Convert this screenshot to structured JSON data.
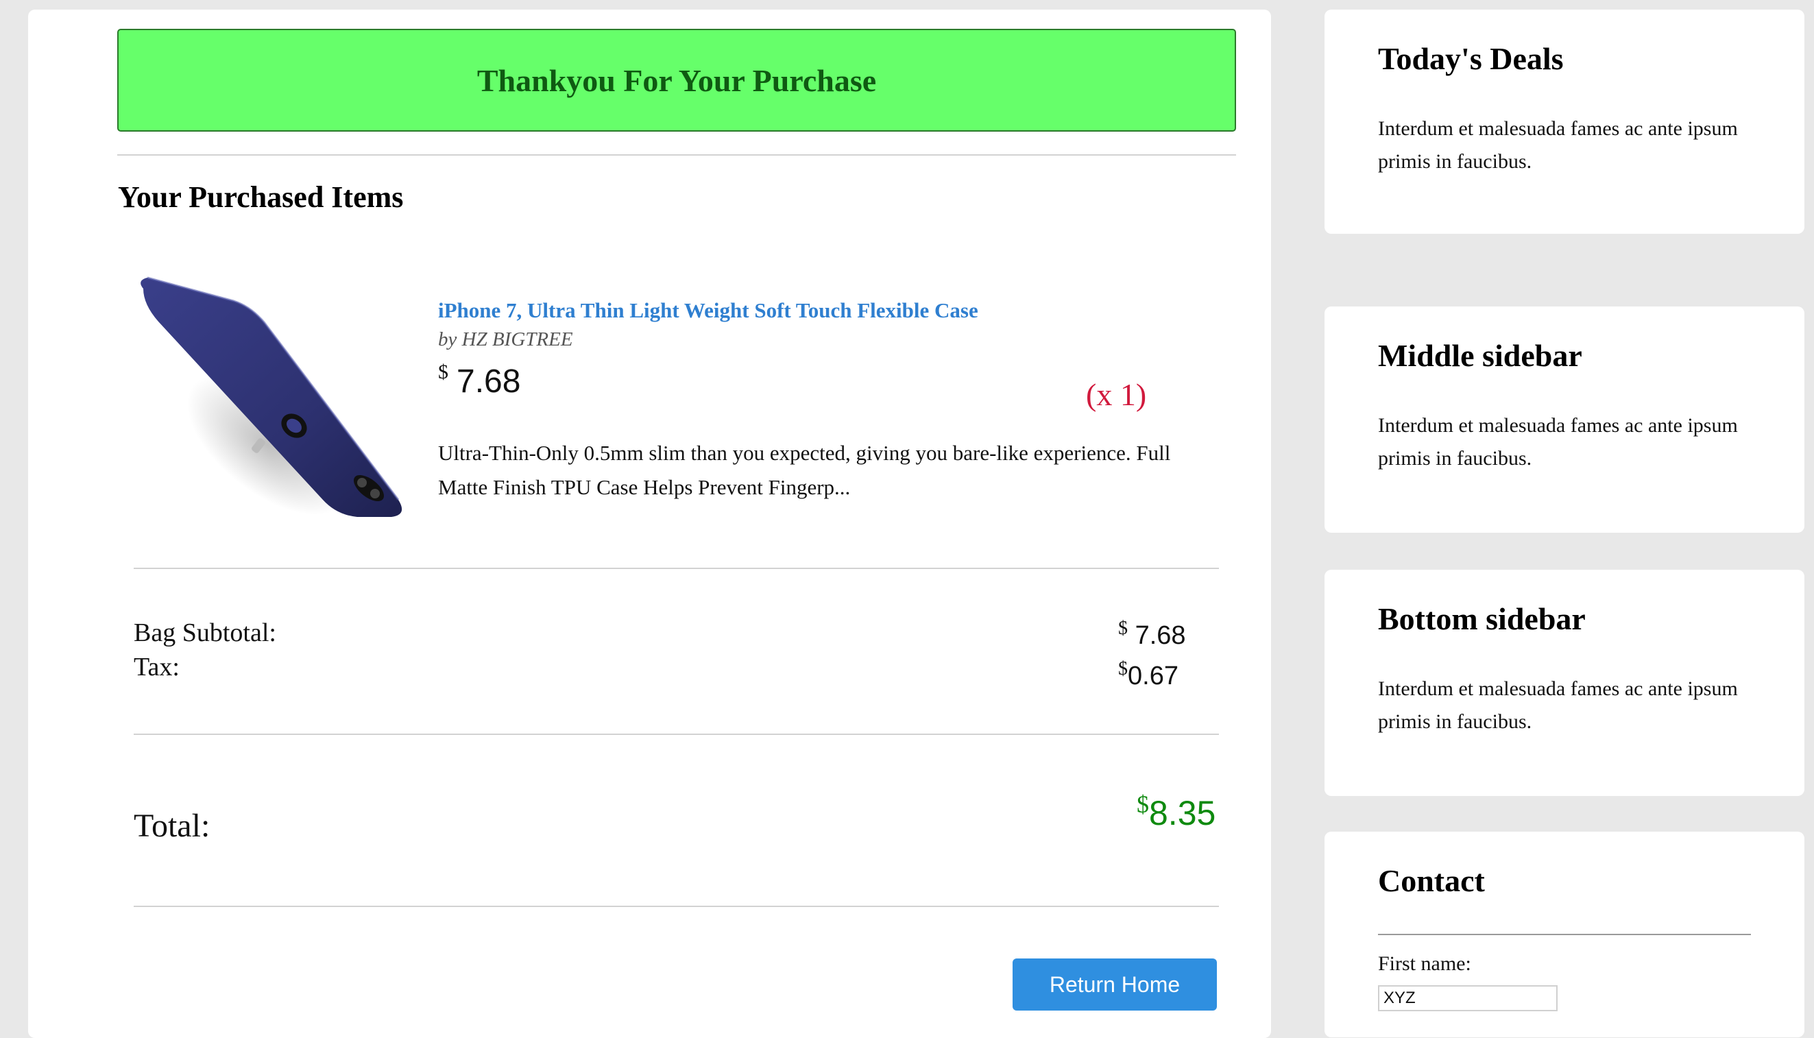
{
  "banner": {
    "text": "Thankyou For Your Purchase"
  },
  "purchased": {
    "heading": "Your Purchased Items",
    "items": [
      {
        "title": "iPhone 7, Ultra Thin Light Weight Soft Touch Flexible Case",
        "brand": "by HZ BIGTREE",
        "currency": "$",
        "price": "7.68",
        "quantity": "(x 1)",
        "description": "Ultra-Thin-Only 0.5mm slim than you expected, giving you bare-like experience. Full Matte Finish TPU Case Helps Prevent Fingerp..."
      }
    ]
  },
  "summary": {
    "subtotal_label": "Bag Subtotal:",
    "subtotal_currency": "$",
    "subtotal_value": "7.68",
    "tax_label": "Tax:",
    "tax_currency": "$",
    "tax_value": "0.67",
    "total_label": "Total:",
    "total_currency": "$",
    "total_value": "8.35",
    "total_color": "#0f8a0f"
  },
  "actions": {
    "return_home_label": "Return Home",
    "button_color": "#2f8fe0"
  },
  "sidebar": {
    "deals": {
      "title": "Today's Deals",
      "text": "Interdum et malesuada fames ac ante ipsum primis in faucibus."
    },
    "middle": {
      "title": "Middle sidebar",
      "text": "Interdum et malesuada fames ac ante ipsum primis in faucibus."
    },
    "bottom": {
      "title": "Bottom sidebar",
      "text": "Interdum et malesuada fames ac ante ipsum primis in faucibus."
    },
    "contact": {
      "title": "Contact",
      "first_name_label": "First name:",
      "first_name_value": "XYZ"
    }
  },
  "colors": {
    "banner_bg": "#66ff6a",
    "banner_text": "#0f5a12",
    "link": "#2f7fd0",
    "quantity": "#d11a3d",
    "page_bg": "#e8e8e8"
  },
  "icons": {
    "product_image": "phone-case-image"
  }
}
